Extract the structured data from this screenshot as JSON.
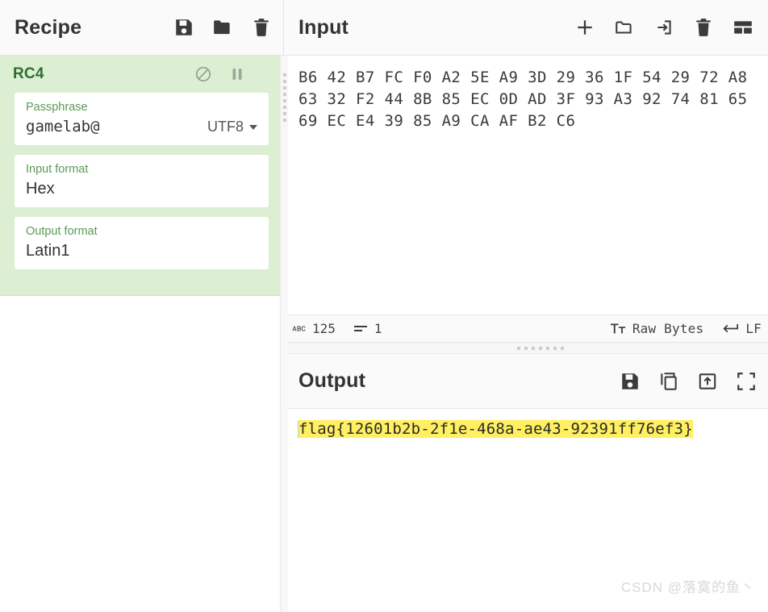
{
  "recipe": {
    "title": "Recipe",
    "icons": [
      {
        "name": "save-recipe-icon",
        "label": "Save recipe"
      },
      {
        "name": "load-recipe-icon",
        "label": "Load recipe"
      },
      {
        "name": "clear-recipe-icon",
        "label": "Clear recipe"
      }
    ],
    "operations": [
      {
        "name": "RC4",
        "disable_label": "Disable operation",
        "breakpoint_label": "Set breakpoint",
        "args": [
          {
            "label": "Passphrase",
            "value": "gamelab@",
            "mono": true,
            "option": "UTF8"
          },
          {
            "label": "Input format",
            "value": "Hex",
            "mono": false,
            "option": null
          },
          {
            "label": "Output format",
            "value": "Latin1",
            "mono": false,
            "option": null
          }
        ]
      }
    ]
  },
  "input": {
    "title": "Input",
    "icons": [
      {
        "name": "add-input-tab-icon",
        "label": "Add a new input tab"
      },
      {
        "name": "open-folder-as-input-icon",
        "label": "Open folder as input"
      },
      {
        "name": "open-file-as-input-icon",
        "label": "Open file as input"
      },
      {
        "name": "clear-input-icon",
        "label": "Clear input and output"
      },
      {
        "name": "reset-pane-layout-icon",
        "label": "Reset pane layout"
      }
    ],
    "lines": [
      "B6 42 B7 FC F0 A2 5E A9 3D 29 36 1F 54 29 72 A8",
      "63 32 F2 44 8B 85 EC 0D AD 3F 93 A3 92 74 81 65",
      "69 EC E4 39 85 A9 CA AF B2 C6"
    ]
  },
  "status": {
    "chars_label": "length",
    "chars": "125",
    "lines_label": "lines",
    "lines": "1",
    "encoding": "Raw Bytes",
    "line_ending": "LF"
  },
  "output": {
    "title": "Output",
    "icons": [
      {
        "name": "save-output-icon",
        "label": "Save output to file"
      },
      {
        "name": "copy-output-icon",
        "label": "Copy raw output to the clipboard"
      },
      {
        "name": "replace-input-with-output-icon",
        "label": "Replace input with output"
      },
      {
        "name": "maximise-output-icon",
        "label": "Maximise output pane"
      }
    ],
    "text": "flag{12601b2b-2f1e-468a-ae43-92391ff76ef3}",
    "highlight_color": "#ffef61"
  },
  "watermark": "CSDN @落寞的鱼丶",
  "theme": {
    "operation_bg": "#dcefd3",
    "operation_accent": "#2d6e31",
    "panel_header_bg": "#fafafa"
  }
}
